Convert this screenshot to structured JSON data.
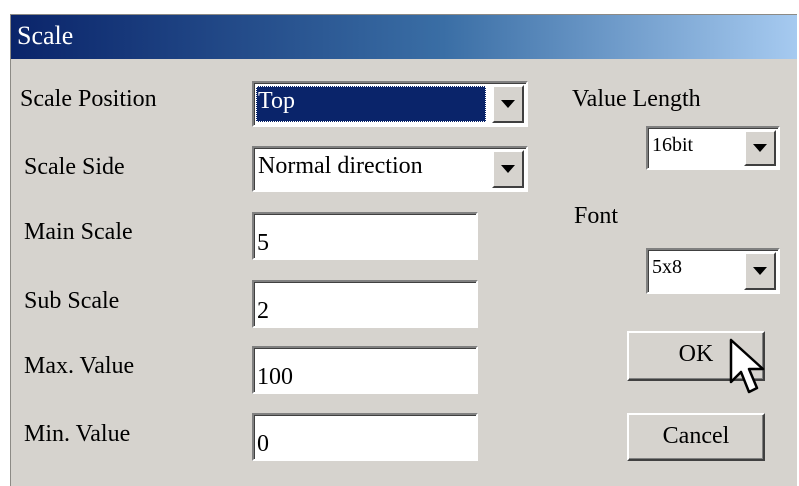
{
  "window": {
    "title": "Scale"
  },
  "fields": {
    "scale_position": {
      "label": "Scale Position",
      "value": "Top"
    },
    "scale_side": {
      "label": "Scale Side",
      "value": "Normal direction"
    },
    "main_scale": {
      "label": "Main Scale",
      "value": "5"
    },
    "sub_scale": {
      "label": "Sub Scale",
      "value": "2"
    },
    "max_value": {
      "label": "Max. Value",
      "value": "100"
    },
    "min_value": {
      "label": "Min. Value",
      "value": "0"
    },
    "value_length": {
      "label": "Value Length",
      "value": "16bit"
    },
    "font": {
      "label": "Font",
      "value": "5x8"
    }
  },
  "buttons": {
    "ok": "OK",
    "cancel": "Cancel"
  },
  "icons": {
    "dropdown": "chevron-down-icon",
    "cursor": "mouse-pointer-icon"
  },
  "colors": {
    "titlebar_start": "#0a246a",
    "titlebar_end": "#a6caf0",
    "dialog_bg": "#d6d3ce",
    "selection_bg": "#0a246a"
  }
}
